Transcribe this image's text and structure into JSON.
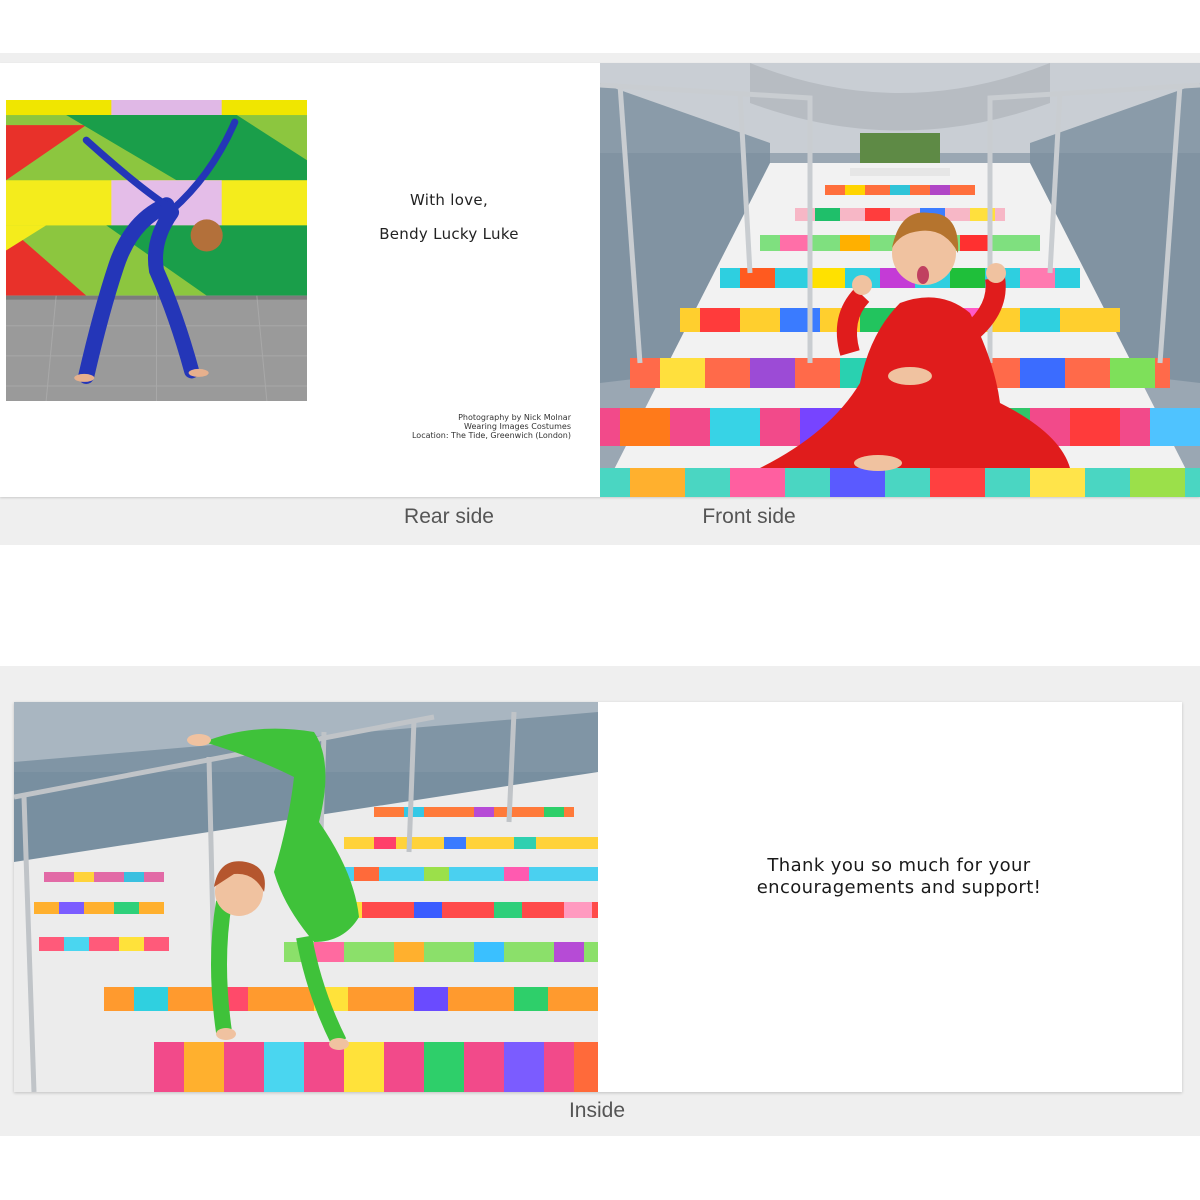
{
  "rear_side": {
    "photo": "dancer-blue-bodysuit-photo",
    "line1": "With love,",
    "line2": "Bendy Lucky Luke",
    "credits": [
      "Photography by Nick Molnar",
      "Wearing Images Costumes",
      "Location: The Tide, Greenwich (London)"
    ],
    "label": "Rear side"
  },
  "front_side": {
    "photo": "boy-red-bodysuit-rainbow-stairs-photo",
    "label": "Front side"
  },
  "inside": {
    "photo": "boy-green-bodysuit-handstand-photo",
    "message_line1": "Thank you so much for your",
    "message_line2": "encouragements and support!",
    "label": "Inside"
  },
  "colors": {
    "band": "#efefef",
    "card": "#ffffff",
    "label_text": "#555555",
    "message_text": "#222222"
  }
}
